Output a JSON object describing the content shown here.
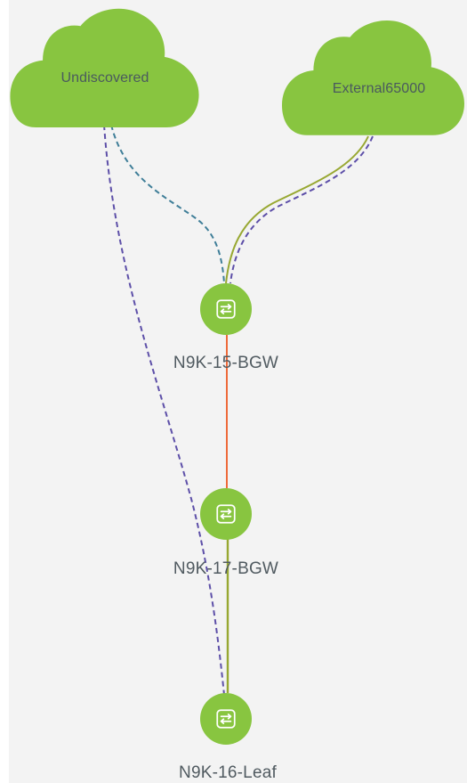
{
  "colors": {
    "canvas_background": "#f3f3f3",
    "cloud_fill": "#88c540",
    "node_fill": "#88c540",
    "node_icon": "#ffffff",
    "link_purple": "#5d4fa8",
    "link_teal": "#3f7e98",
    "link_olive": "#98a832",
    "link_orange": "#ee6a3a"
  },
  "clouds": [
    {
      "id": "undiscovered",
      "label": "Undiscovered",
      "icon": "cloud-icon"
    },
    {
      "id": "external",
      "label": "External65000",
      "icon": "cloud-icon"
    }
  ],
  "nodes": [
    {
      "id": "n15",
      "label": "N9K-15-BGW",
      "icon": "switch-icon"
    },
    {
      "id": "n17",
      "label": "N9K-17-BGW",
      "icon": "switch-icon"
    },
    {
      "id": "n16",
      "label": "N9K-16-Leaf",
      "icon": "switch-icon"
    }
  ],
  "links": [
    {
      "from": "undiscovered",
      "to": "n15",
      "style": "dashed",
      "color": "purple"
    },
    {
      "from": "undiscovered",
      "to": "n16",
      "style": "dashed",
      "color": "teal"
    },
    {
      "from": "external",
      "to": "n15",
      "style": "solid",
      "color": "olive"
    },
    {
      "from": "external",
      "to": "n15",
      "style": "dashed",
      "color": "purple"
    },
    {
      "from": "n15",
      "to": "n17",
      "style": "solid",
      "color": "orange"
    },
    {
      "from": "n17",
      "to": "n16",
      "style": "solid",
      "color": "olive"
    }
  ]
}
